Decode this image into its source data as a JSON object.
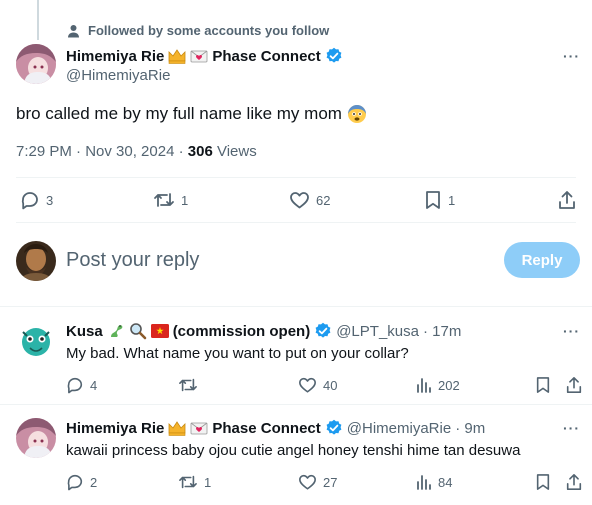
{
  "social_context": "Followed by some accounts you follow",
  "main_post": {
    "display_name": "Himemiya Rie",
    "affiliation": "Phase Connect",
    "handle": "@HimemiyaRie",
    "text": "bro called me by my full name like my mom",
    "emoji": "😨",
    "time": "7:29 PM · Nov 30, 2024 · ",
    "views_count": "306",
    "views_label": "Views",
    "stats": {
      "replies": "3",
      "reposts": "1",
      "likes": "62",
      "bookmarks": "1"
    }
  },
  "composer": {
    "placeholder": "Post your reply",
    "reply_label": "Reply"
  },
  "replies": [
    {
      "display_name": "Kusa",
      "name_suffix": "(commission open)",
      "handle": "@LPT_kusa",
      "time": "· 17m",
      "text": "My bad. What name you want to put on your collar?",
      "stats": {
        "replies": "4",
        "reposts": "",
        "likes": "40",
        "views": "202"
      }
    },
    {
      "display_name": "Himemiya Rie",
      "affiliation": "Phase Connect",
      "handle": "@HimemiyaRie",
      "time": "· 9m",
      "text": "kawaii princess baby ojou cutie angel honey tenshi hime tan desuwa",
      "stats": {
        "replies": "2",
        "reposts": "1",
        "likes": "27",
        "views": "84"
      }
    }
  ],
  "colors": {
    "accent": "#1d9bf0",
    "reply_button_disabled": "#8ecdf8",
    "text_secondary": "#536471",
    "divider": "#eff3f4"
  }
}
